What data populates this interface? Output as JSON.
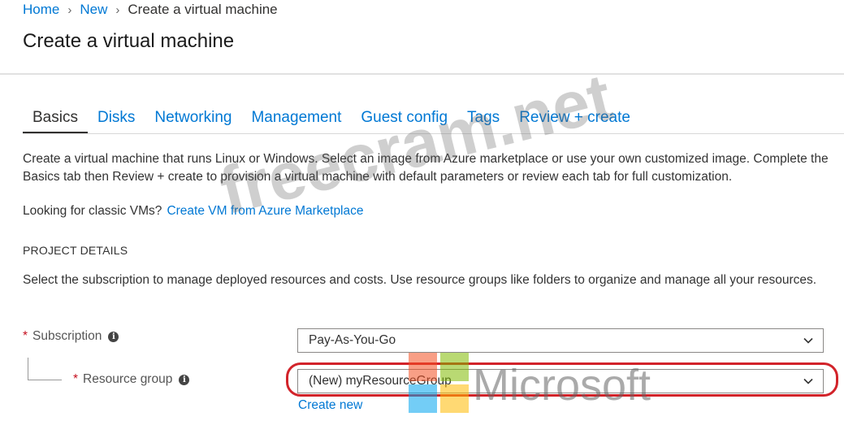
{
  "breadcrumb": {
    "home": "Home",
    "new": "New",
    "current": "Create a virtual machine"
  },
  "page": {
    "title": "Create a virtual machine"
  },
  "tabs": [
    {
      "label": "Basics",
      "active": true
    },
    {
      "label": "Disks"
    },
    {
      "label": "Networking"
    },
    {
      "label": "Management"
    },
    {
      "label": "Guest config"
    },
    {
      "label": "Tags"
    },
    {
      "label": "Review + create"
    }
  ],
  "intro": {
    "text": "Create a virtual machine that runs Linux or Windows. Select an image from Azure marketplace or use your own customized image. Complete the Basics tab then Review + create to provision a virtual machine with default parameters or review each tab for full customization.",
    "classic_prefix": "Looking for classic VMs?",
    "classic_link": "Create VM from Azure Marketplace"
  },
  "project": {
    "heading": "PROJECT DETAILS",
    "description": "Select the subscription to manage deployed resources and costs. Use resource groups like folders to organize and manage all your resources."
  },
  "form": {
    "subscription": {
      "required_mark": "*",
      "label": "Subscription",
      "value": "Pay-As-You-Go"
    },
    "resource_group": {
      "required_mark": "*",
      "label": "Resource group",
      "value": "(New) myResourceGroup",
      "create_new": "Create new"
    }
  },
  "icons": {
    "info": "info-icon",
    "chevron": "chevron-down-icon",
    "separator": "chevron-right-icon"
  },
  "colors": {
    "link": "#0078d4",
    "required": "#c50f1f",
    "highlight_ring": "#d2232a"
  },
  "watermark": {
    "site": "freecram.net",
    "brand": "Microsoft"
  }
}
